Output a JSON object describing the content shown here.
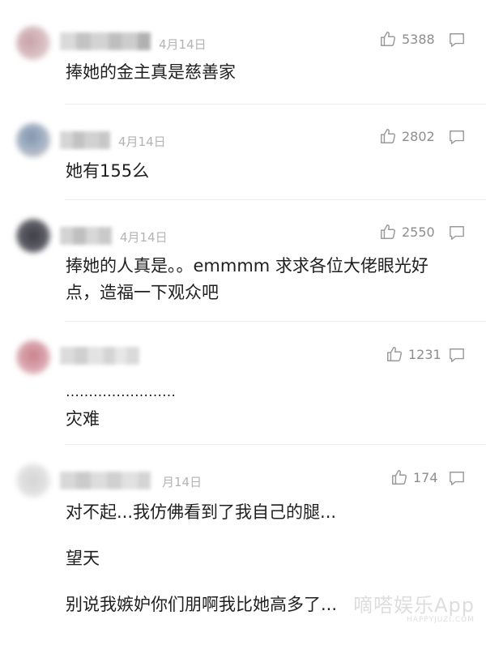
{
  "comments": [
    {
      "date": "4月14日",
      "likes": "5388",
      "lines": [
        "捧她的金主真是慈善家"
      ]
    },
    {
      "date": "4月14日",
      "likes": "2802",
      "lines": [
        "她有155么"
      ]
    },
    {
      "date": "4月14日",
      "likes": "2550",
      "lines": [
        "捧她的人真是。。emmmm 求求各位大佬眼光好",
        "点，造福一下观众吧"
      ]
    },
    {
      "date": "",
      "likes": "1231",
      "lines": [
        "……………………",
        "灾难"
      ]
    },
    {
      "date": "月14日",
      "likes": "174",
      "lines": [
        "对不起...我仿佛看到了我自己的腿...",
        "望天",
        "别说我嫉妒你们朋啊我比她高多了..."
      ]
    }
  ],
  "watermark": {
    "main": "嘀嗒娱乐App",
    "sub": "HAPPYJUZI.COM"
  },
  "icons": {
    "like": "thumbs-up-icon",
    "reply": "comment-bubble-icon"
  },
  "colors": {
    "text": "#1f1f1f",
    "meta": "#b3b3b3",
    "icon": "#9a9a9a",
    "divider": "#ececec"
  }
}
